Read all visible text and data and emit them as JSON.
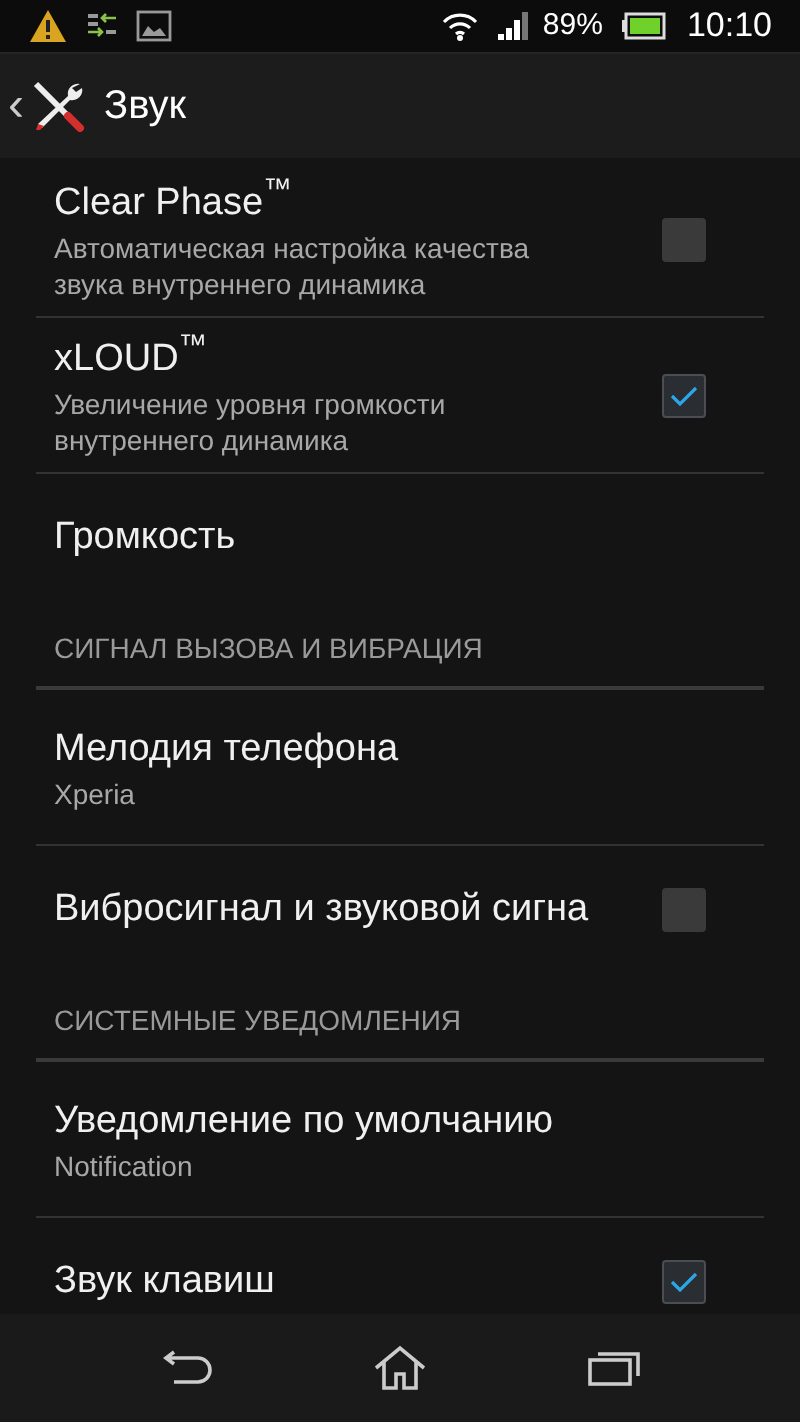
{
  "status_bar": {
    "battery": "89%",
    "time": "10:10"
  },
  "action_bar": {
    "back": "‹",
    "title": "Звук"
  },
  "items": [
    {
      "kind": "checkbox",
      "title": "Clear Phase$^{™}$",
      "summary": "Автоматическая настройка качества звука внутреннего динамика",
      "checked": false
    },
    {
      "kind": "checkbox",
      "title": "xLOUD$^{™}$",
      "summary": "Увеличение уровня громкости внутреннего динамика",
      "checked": true
    },
    {
      "kind": "text",
      "title": "Громкость"
    },
    {
      "kind": "header",
      "title": "СИГНАЛ ВЫЗОВА И ВИБРАЦИЯ"
    },
    {
      "kind": "text",
      "title": "Мелодия телефона",
      "summary": "Xperia"
    },
    {
      "kind": "checkbox",
      "title": "Вибросигнал и звуковой сигна",
      "checked": false
    },
    {
      "kind": "header",
      "title": "СИСТЕМНЫЕ УВЕДОМЛЕНИЯ"
    },
    {
      "kind": "text",
      "title": "Уведомление по умолчанию",
      "summary": "Notification"
    },
    {
      "kind": "checkbox",
      "title": "Звук клавиш",
      "checked": true
    }
  ]
}
